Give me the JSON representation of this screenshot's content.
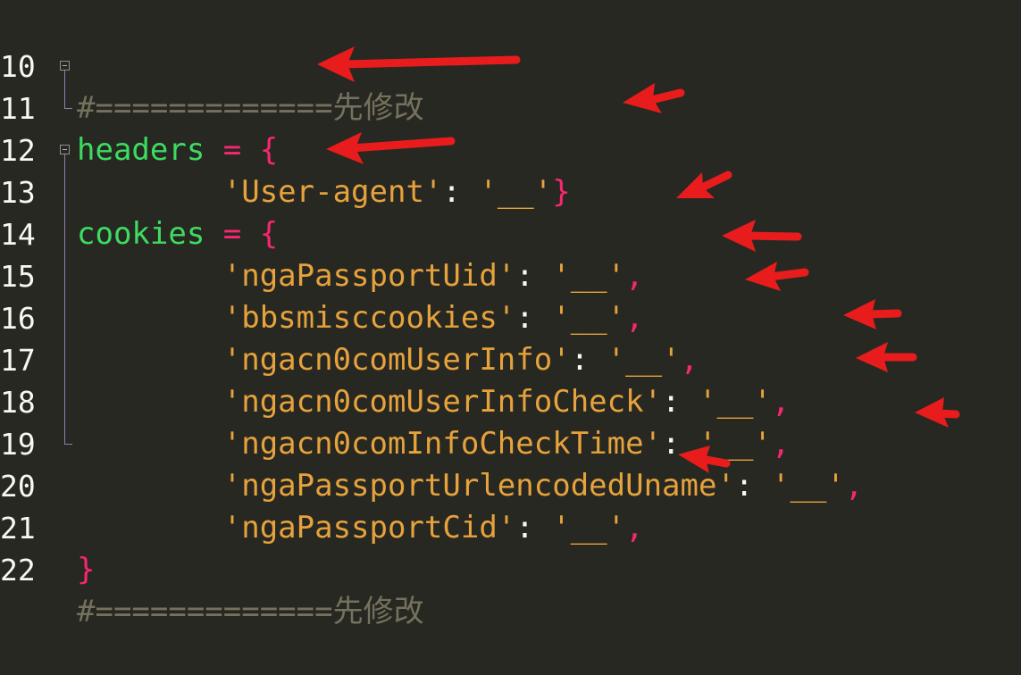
{
  "editor": {
    "lines": [
      {
        "num": "10",
        "comment": "#=============",
        "cjk": "先修改"
      },
      {
        "num": "11",
        "ident": "headers",
        "op": " = ",
        "brace": "{"
      },
      {
        "num": "12",
        "indent": "        ",
        "key": "'User-agent'",
        "colon": ": ",
        "val": "'__'",
        "end": "}"
      },
      {
        "num": "13",
        "ident": "cookies",
        "op": " = ",
        "brace": "{"
      },
      {
        "num": "14",
        "indent": "        ",
        "key": "'ngaPassportUid'",
        "colon": ": ",
        "val": "'__'",
        "end": ","
      },
      {
        "num": "15",
        "indent": "        ",
        "key": "'bbsmisccookies'",
        "colon": ": ",
        "val": "'__'",
        "end": ","
      },
      {
        "num": "16",
        "indent": "        ",
        "key": "'ngacn0comUserInfo'",
        "colon": ": ",
        "val": "'__'",
        "end": ","
      },
      {
        "num": "17",
        "indent": "        ",
        "key": "'ngacn0comUserInfoCheck'",
        "colon": ": ",
        "val": "'__'",
        "end": ","
      },
      {
        "num": "18",
        "indent": "        ",
        "key": "'ngacn0comInfoCheckTime'",
        "colon": ": ",
        "val": "'__'",
        "end": ","
      },
      {
        "num": "19",
        "indent": "        ",
        "key": "'ngaPassportUrlencodedUname'",
        "colon": ": ",
        "val": "'__'",
        "end": ","
      },
      {
        "num": "20",
        "indent": "        ",
        "key": "'ngaPassportCid'",
        "colon": ": ",
        "val": "'__'",
        "end": ","
      },
      {
        "num": "21",
        "brace": "}"
      },
      {
        "num": "22",
        "comment": "#=============",
        "cjk": "先修改"
      }
    ]
  },
  "colors": {
    "background": "#272822",
    "identifier": "#3cdc61",
    "operator": "#f92672",
    "string": "#e6a23c",
    "comment": "#75715e",
    "arrow": "#e81c1c"
  }
}
